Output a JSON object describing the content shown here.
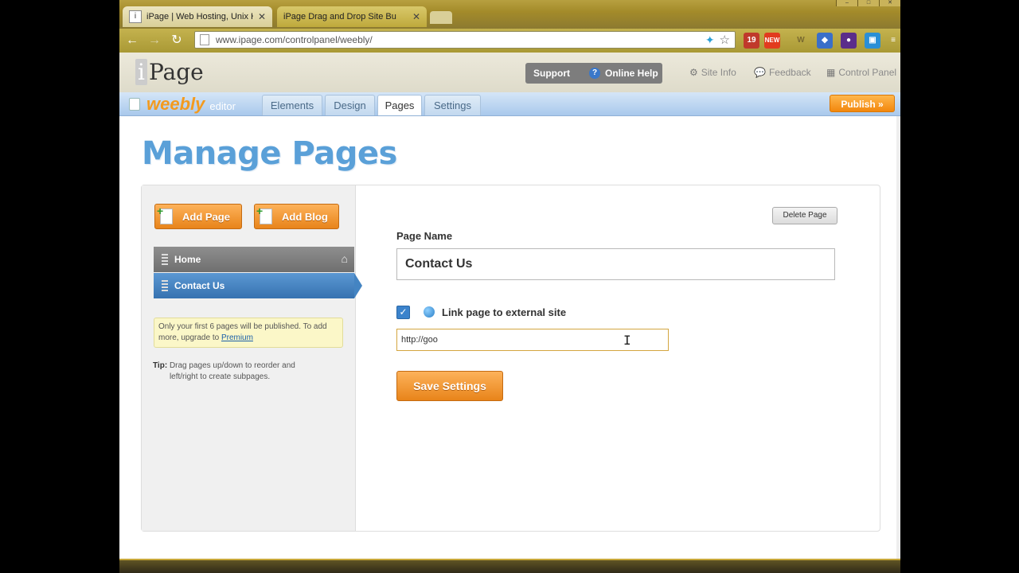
{
  "browser": {
    "tabs": [
      {
        "label": "iPage | Web Hosting, Unix Ho",
        "favicon": "i"
      },
      {
        "label": "iPage Drag and Drop Site Bu",
        "favicon": ""
      }
    ],
    "url": "www.ipage.com/controlpanel/weebly/",
    "ext_badge_new": "NEW",
    "ext_badge_count": "19"
  },
  "ipage_header": {
    "logo": "Page",
    "support": "Support",
    "online_help": "Online Help",
    "site_info": "Site Info",
    "feedback": "Feedback",
    "control_panel": "Control Panel"
  },
  "weebly_bar": {
    "logo": "weebly",
    "editor": "editor",
    "tabs": [
      "Elements",
      "Design",
      "Pages",
      "Settings"
    ],
    "active_tab": "Pages",
    "publish": "Publish »"
  },
  "main": {
    "heading": "Manage Pages",
    "add_page": "Add Page",
    "add_blog": "Add Blog",
    "pages": [
      "Home",
      "Contact Us"
    ],
    "notice_text": "Only your first 6 pages will be published. To add more, upgrade to ",
    "notice_link": "Premium",
    "tip_label": "Tip:",
    "tip_text": "Drag pages up/down to reorder and left/right to create subpages.",
    "delete_page": "Delete Page",
    "page_name_label": "Page Name",
    "page_name_value": "Contact Us",
    "external_link_label": "Link page to external site",
    "external_link_checked": true,
    "external_url_value": "http://goo",
    "save_settings": "Save Settings"
  },
  "colors": {
    "accent_orange": "#f2870d",
    "weebly_blue": "#5aa0d8",
    "selected_page": "#3672b0"
  }
}
